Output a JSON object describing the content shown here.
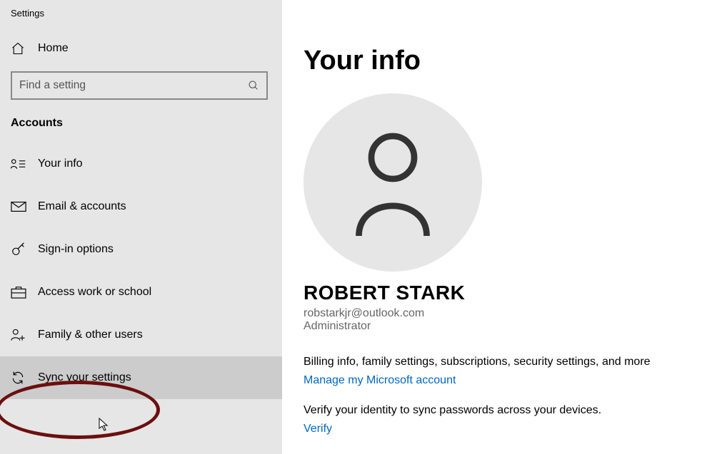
{
  "app_title": "Settings",
  "home_label": "Home",
  "search": {
    "placeholder": "Find a setting"
  },
  "section_header": "Accounts",
  "nav": [
    {
      "id": "your-info",
      "label": "Your info"
    },
    {
      "id": "email-accounts",
      "label": "Email & accounts"
    },
    {
      "id": "sign-in-options",
      "label": "Sign-in options"
    },
    {
      "id": "access-work-school",
      "label": "Access work or school"
    },
    {
      "id": "family-other-users",
      "label": "Family & other users"
    },
    {
      "id": "sync-your-settings",
      "label": "Sync your settings"
    }
  ],
  "main": {
    "title": "Your info",
    "user_name": "ROBERT STARK",
    "user_email": "robstarkjr@outlook.com",
    "user_role": "Administrator",
    "billing_desc": "Billing info, family settings, subscriptions, security settings, and more",
    "manage_link": "Manage my Microsoft account",
    "verify_desc": "Verify your identity to sync passwords across your devices.",
    "verify_link": "Verify"
  }
}
